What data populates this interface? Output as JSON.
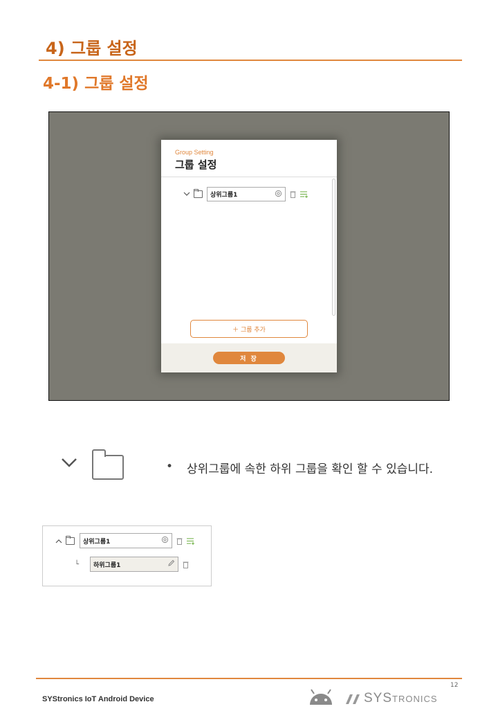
{
  "section_title": "4) 그룹 설정",
  "subsection_title": "4-1) 그룹 설정",
  "screen": {
    "subtitle": "Group Setting",
    "title": "그룹 설정",
    "group_name": "상위그룹1",
    "add_group_label": "＋ 그룹 추가",
    "save_label": "저 장"
  },
  "description": {
    "bullet": "•",
    "text": "상위그룹에 속한 하위 그룹을 확인 할 수 있습니다."
  },
  "example": {
    "parent_group": "상위그룹1",
    "child_group": "하위그룹1",
    "child_connector": "└"
  },
  "footer": {
    "page_number": "12",
    "doc_name": "SYStronics IoT Android Device",
    "logo_text_big": "SYS",
    "logo_text_small": "TRONICS"
  },
  "colors": {
    "accent": "#e0873d",
    "heading": "#c8651a",
    "green": "#6aad3d"
  },
  "icons": [
    "chevron-down-icon",
    "chevron-up-icon",
    "folder-icon",
    "gear-icon",
    "trash-icon",
    "add-subgroup-icon",
    "pencil-icon",
    "android-icon",
    "systronics-logo"
  ]
}
